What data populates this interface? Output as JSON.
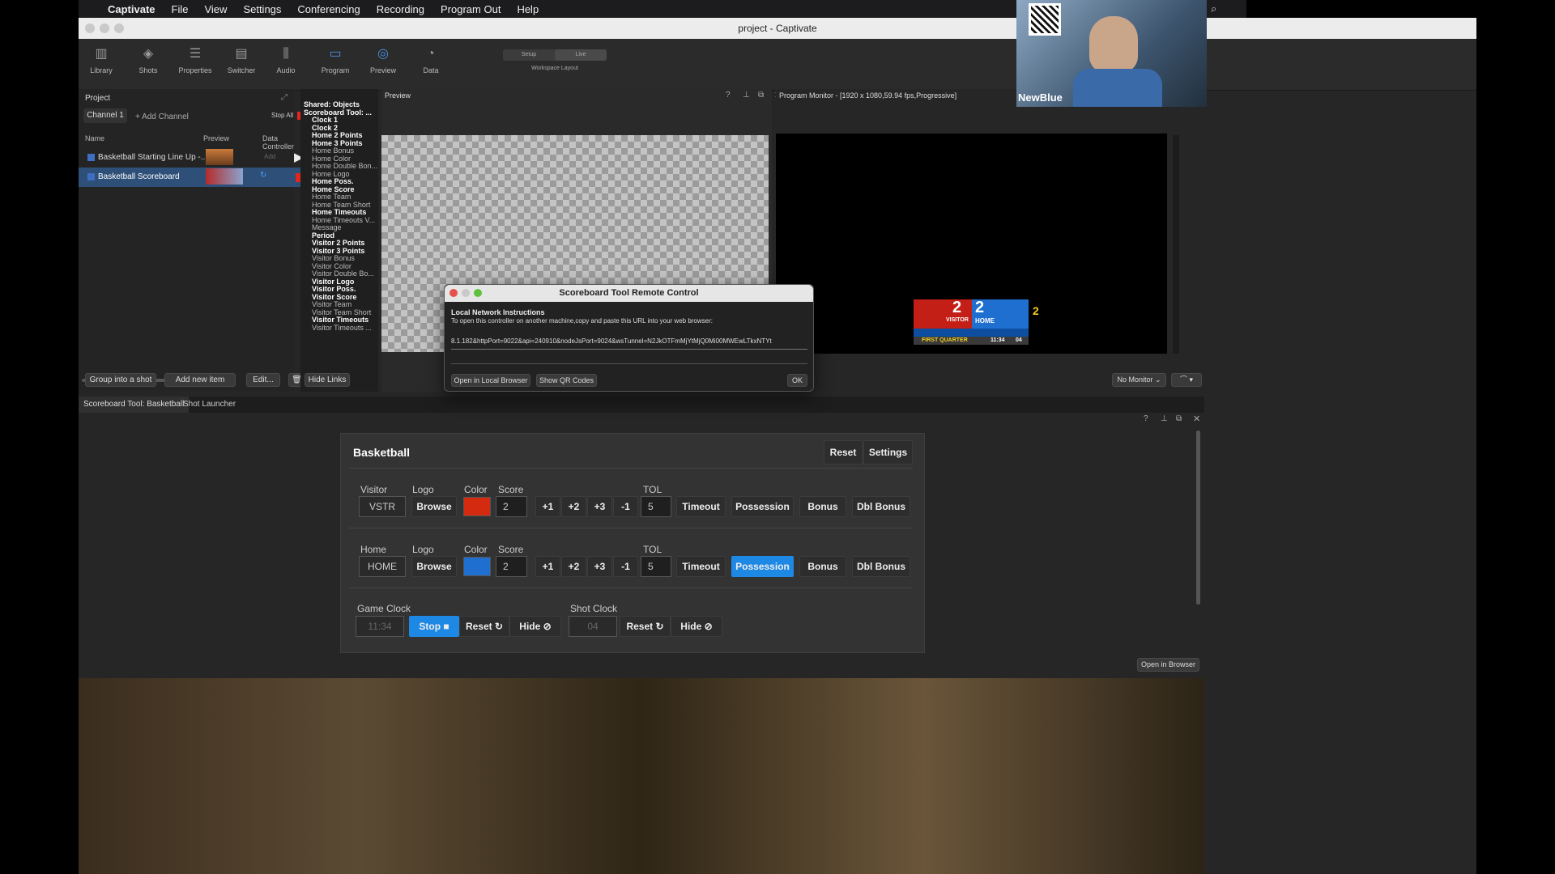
{
  "menubar": {
    "app": "Captivate",
    "items": [
      "File",
      "View",
      "Settings",
      "Conferencing",
      "Recording",
      "Program Out",
      "Help"
    ]
  },
  "window": {
    "title": "project - Captivate"
  },
  "toolbar": {
    "items": [
      {
        "label": "Library",
        "icon": "library-icon"
      },
      {
        "label": "Shots",
        "icon": "shots-icon"
      },
      {
        "label": "Properties",
        "icon": "properties-icon"
      },
      {
        "label": "Switcher",
        "icon": "switcher-icon"
      },
      {
        "label": "Audio",
        "icon": "audio-icon"
      },
      {
        "label": "Program",
        "icon": "program-icon"
      },
      {
        "label": "Preview",
        "icon": "preview-icon"
      },
      {
        "label": "Data",
        "icon": "data-icon"
      }
    ],
    "workspace": {
      "setup": "Setup",
      "live": "Live",
      "caption": "Workspace Layout"
    }
  },
  "project": {
    "title": "Project",
    "channel_tab": "Channel 1",
    "add_channel": "+ Add Channel",
    "stop_all": "Stop All",
    "columns": {
      "name": "Name",
      "preview": "Preview",
      "data": "Data Controller"
    },
    "rows": [
      {
        "name": "Basketball Starting Line Up -...",
        "data": "Add"
      },
      {
        "name": "Basketball Scoreboard",
        "data": ""
      }
    ],
    "buttons": {
      "group": "Group into a shot",
      "add": "Add new item",
      "edit": "Edit..."
    }
  },
  "links": {
    "items": [
      {
        "text": "Shared: Objects",
        "bold": true
      },
      {
        "text": "Scoreboard Tool: ...",
        "bold": true
      },
      {
        "text": "Clock 1",
        "bold": true
      },
      {
        "text": "Clock 2",
        "bold": true
      },
      {
        "text": "Home 2 Points",
        "bold": true
      },
      {
        "text": "Home 3 Points",
        "bold": true
      },
      {
        "text": "Home Bonus",
        "bold": false
      },
      {
        "text": "Home Color",
        "bold": false
      },
      {
        "text": "Home Double Bon...",
        "bold": false
      },
      {
        "text": "Home Logo",
        "bold": false
      },
      {
        "text": "Home Poss.",
        "bold": true
      },
      {
        "text": "Home Score",
        "bold": true
      },
      {
        "text": "Home Team",
        "bold": false
      },
      {
        "text": "Home Team Short",
        "bold": false
      },
      {
        "text": "Home Timeouts",
        "bold": true
      },
      {
        "text": "Home Timeouts V...",
        "bold": false
      },
      {
        "text": "Message",
        "bold": false
      },
      {
        "text": "Period",
        "bold": true
      },
      {
        "text": "Visitor 2 Points",
        "bold": true
      },
      {
        "text": "Visitor 3 Points",
        "bold": true
      },
      {
        "text": "Visitor Bonus",
        "bold": false
      },
      {
        "text": "Visitor Color",
        "bold": false
      },
      {
        "text": "Visitor Double Bo...",
        "bold": false
      },
      {
        "text": "Visitor Logo",
        "bold": true
      },
      {
        "text": "Visitor Poss.",
        "bold": true
      },
      {
        "text": "Visitor Score",
        "bold": true
      },
      {
        "text": "Visitor Team",
        "bold": false
      },
      {
        "text": "Visitor Team Short",
        "bold": false
      },
      {
        "text": "Visitor Timeouts",
        "bold": true
      },
      {
        "text": "Visitor Timeouts ...",
        "bold": false
      }
    ],
    "hide_links": "Hide Links"
  },
  "preview": {
    "title": "Preview"
  },
  "program": {
    "title": "Program Monitor - [1920 x 1080,59.94 fps,Progressive]",
    "no_monitor": "No Monitor",
    "scorebug": {
      "visitor_score": "2",
      "visitor_label": "VISITOR",
      "home_score": "2",
      "home_label": "HOME",
      "period": "FIRST QUARTER",
      "clock": "11:34",
      "shot": "04",
      "extra": "2"
    }
  },
  "dialog": {
    "title": "Scoreboard Tool Remote Control",
    "heading": "Local Network Instructions",
    "instructions": "To open this controller on another machine,copy and paste this URL into your web browser:",
    "url": "8.1.182&httpPort=9022&api=240910&nodeJsPort=9024&wsTunnel=N2JkOTFmMjYtMjQ0Mi00MWEwLTkxNTYt",
    "open_local": "Open in Local Browser",
    "show_qr": "Show QR Codes",
    "ok": "OK"
  },
  "bottom_tabs": [
    "Scoreboard Tool: Basketball",
    "Shot Launcher"
  ],
  "scoreboard": {
    "title": "Basketball",
    "reset": "Reset",
    "settings": "Settings",
    "labels": {
      "logo": "Logo",
      "color": "Color",
      "score": "Score",
      "tol": "TOL"
    },
    "visitor": {
      "label": "Visitor",
      "team": "VSTR",
      "browse": "Browse",
      "color": "#d42a0f",
      "score": "2",
      "tol": "5"
    },
    "home": {
      "label": "Home",
      "team": "HOME",
      "browse": "Browse",
      "color": "#1f6fd1",
      "score": "2",
      "tol": "5"
    },
    "point_buttons": [
      "+1",
      "+2",
      "+3",
      "-1"
    ],
    "actions": {
      "timeout": "Timeout",
      "possession": "Possession",
      "bonus": "Bonus",
      "dbl_bonus": "Dbl Bonus"
    },
    "game_clock": {
      "label": "Game Clock",
      "value": "11:34",
      "stop": "Stop",
      "reset": "Reset",
      "hide": "Hide"
    },
    "shot_clock": {
      "label": "Shot Clock",
      "value": "04",
      "reset": "Reset",
      "hide": "Hide"
    },
    "open_browser": "Open in Browser"
  },
  "webcam": {
    "brand": "NewBlue"
  }
}
